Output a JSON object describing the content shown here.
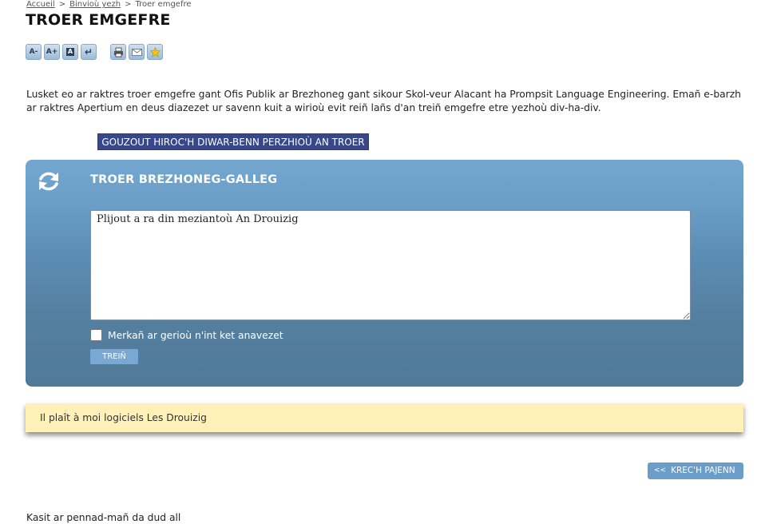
{
  "breadcrumb": {
    "items": [
      "Accueil",
      "Binvioù yezh"
    ],
    "current": "Troer emgefre",
    "separator": ">"
  },
  "page_title": "TROER EMGEFRE",
  "tools": {
    "font_smaller": "A-",
    "font_larger": "A+",
    "contrast": "A",
    "back": "↵",
    "icons": [
      "font-decrease-icon",
      "font-increase-icon",
      "contrast-icon",
      "return-icon",
      "print-icon",
      "mail-icon",
      "favorite-icon"
    ]
  },
  "intro": "Lusket eo ar raktres troer emgefre gant Ofis Publik ar Brezhoneg gant sikour Skol-veur Alacant ha Prompsit Language Engineering. Emañ e-barzh ar raktres Apertium en deus diazezet ur savenn kuit a wirioù evit reiñ lañs d'an treiñ emgefre etre yezhoù div-ha-div.",
  "about_button": "GOUZOUT HIROC'H DIWAR-BENN PERZHIOÙ AN TROER",
  "translator": {
    "title": "TROER BREZHONEG-GALLEG",
    "input_text": "Plijout a ra din meziantoù An Drouizig",
    "checkbox_label": "Merkañ ar gerioù n'int ket anavezet",
    "checkbox_checked": false,
    "translate_button": "TREIÑ"
  },
  "result_text": "Il plaît à moi logiciels Les Drouizig",
  "back_button": {
    "chevron": "<<",
    "label": "KREC'H PAJENN"
  },
  "footer_text": "Kasit ar pennad-mañ da dud all",
  "colors": {
    "panel_top": "#73a7d0",
    "panel_bottom": "#517a99",
    "about_button": "#37478a",
    "result_background": "#fff1b8",
    "accent_button": "#6a9ec9"
  }
}
